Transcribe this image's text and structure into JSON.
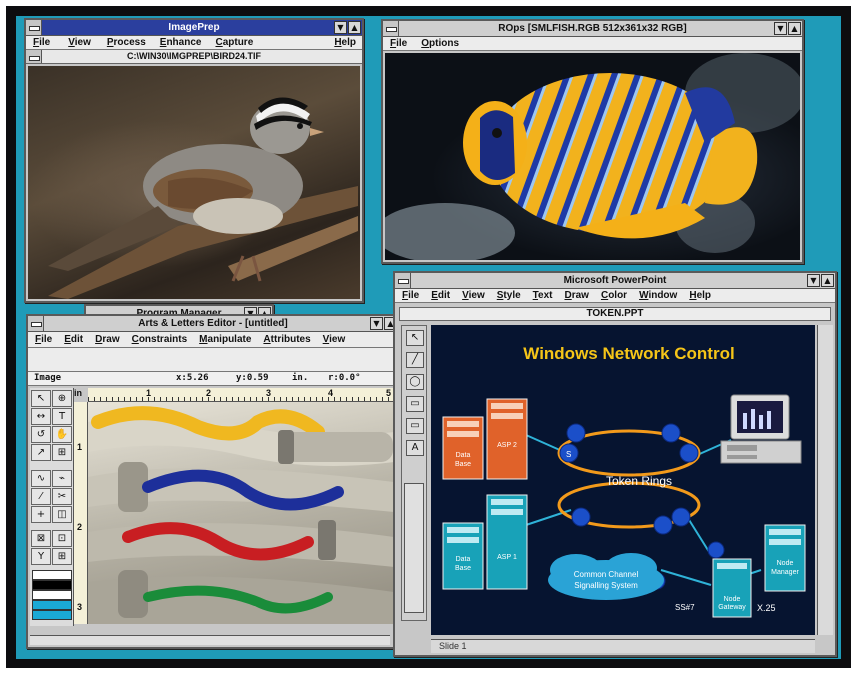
{
  "imageprep": {
    "title": "ImagePrep",
    "menu": [
      "File",
      "View",
      "Process",
      "Enhance",
      "Capture"
    ],
    "help": "Help",
    "path": "C:\\WIN30\\IMGPREP\\BIRD24.TIF"
  },
  "rops": {
    "title": "ROps [SMLFISH.RGB 512x361x32 RGB]",
    "menu": [
      "File",
      "Options"
    ]
  },
  "progman": {
    "title": "Program Manager"
  },
  "arts": {
    "title": "Arts & Letters Editor - [untitled]",
    "menu": [
      "File",
      "Edit",
      "Draw",
      "Constraints",
      "Manipulate",
      "Attributes",
      "View"
    ],
    "status": {
      "mode": "Image",
      "x": "x:5.26",
      "y": "y:0.59",
      "unit": "in.",
      "r": "r:0.0°"
    },
    "ruler_unit": "in",
    "ruler_top": [
      "1",
      "2",
      "3",
      "4",
      "5"
    ],
    "ruler_left": [
      "1",
      "2",
      "3"
    ],
    "tools": [
      "↖",
      "⊕",
      "↔",
      "T",
      "↺",
      "✋",
      "↗",
      "⊞",
      "∿",
      "⌁",
      "⁄",
      "✂",
      "+",
      "◫",
      "⊠",
      "⊡",
      "Y",
      "⊞"
    ],
    "swatches": [
      "#ffffff",
      "#000000",
      "#ffffff",
      "#1aa9d6",
      "#1aa9d6",
      "#1aa9d6"
    ]
  },
  "ppt": {
    "title": "Microsoft PowerPoint",
    "menu": [
      "File",
      "Edit",
      "View",
      "Style",
      "Text",
      "Draw",
      "Color",
      "Window"
    ],
    "help": "Help",
    "document": "TOKEN.PPT",
    "status": "Slide    1",
    "tools": [
      "↖",
      "╱",
      "◯",
      "▭",
      "▭",
      "A"
    ],
    "slide": {
      "title": "Windows Network Control",
      "ring_label": "Token Rings",
      "servers": [
        {
          "lines": [
            "Data",
            "Base"
          ],
          "color": "#e0622a"
        },
        {
          "lines": [
            "ASP 2"
          ],
          "color": "#e0622a"
        },
        {
          "lines": [
            "Data",
            "Base"
          ],
          "color": "#18a2b8"
        },
        {
          "lines": [
            "ASP 1"
          ],
          "color": "#18a2b8"
        },
        {
          "lines": [
            "Node",
            "Gateway"
          ],
          "color": "#18a2b8"
        },
        {
          "lines": [
            "Node",
            "Manager"
          ],
          "color": "#18a2b8"
        }
      ],
      "cloud_lines": [
        "Common Channel",
        "Signalling System"
      ],
      "labels": {
        "ss7": "SS#7",
        "x25": "X.25",
        "ring_node": "S"
      }
    }
  }
}
